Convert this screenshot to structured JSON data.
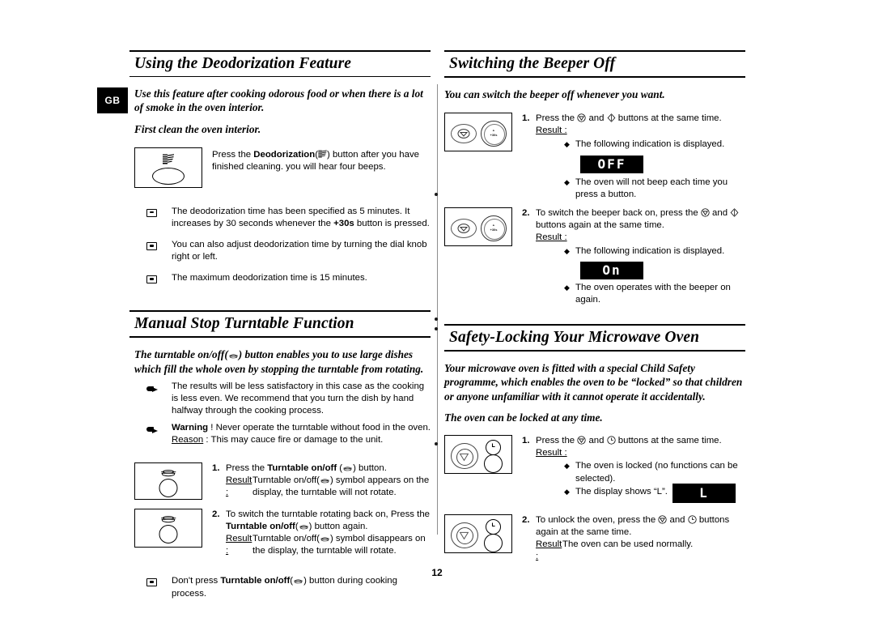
{
  "locale_badge": "GB",
  "page_number": "12",
  "left_column": {
    "sections": [
      {
        "id": "deodorization",
        "title": "Using the Deodorization Feature",
        "intro_1": "Use this feature after cooking odorous food or when there is a lot of smoke in the oven interior.",
        "intro_2": "First clean the oven interior.",
        "panel_icon": "deodorization-icon",
        "instruction_pre": "Press the ",
        "instruction_bold": "Deodorization",
        "instruction_paren_open": "(",
        "instruction_paren_close": ")",
        "instruction_post": " button after you have finished cleaning. you will hear four beeps.",
        "notes": [
          {
            "icon": "tv-note-icon",
            "text_pre": "The deodorization time has been specified as 5 minutes. It increases by 30 seconds whenever the ",
            "text_bold": "+30s",
            "text_post": " button is pressed."
          },
          {
            "icon": "tv-note-icon",
            "text_pre": "You can also adjust deodorization time by turning the dial knob right or left.",
            "text_bold": "",
            "text_post": ""
          },
          {
            "icon": "tv-note-icon",
            "text_pre": "The maximum deodorization time is 15 minutes.",
            "text_bold": "",
            "text_post": ""
          }
        ]
      },
      {
        "id": "manual-stop-turntable",
        "title": "Manual Stop Turntable Function",
        "intro_1_a": "The turntable on/off(",
        "intro_1_b": ") button enables you to use large dishes which fill the whole oven by stopping the turntable from rotating.",
        "hand_notes": [
          {
            "icon": "hand-note-icon",
            "text": "The results will be less satisfactory in this case as the cooking is less even. We recommend that you turn the dish by hand halfway through the cooking process."
          }
        ],
        "warning": {
          "icon": "hand-note-icon",
          "bold": "Warning",
          "text": " ! Never operate the turntable without food in the oven.",
          "reason_label": "Reason",
          "reason_text": " : This may cauce fire or damage to the unit."
        },
        "steps": [
          {
            "num": "1.",
            "line_pre": "Press the ",
            "line_bold": "Turntable on/off",
            "line_paren_open": " (",
            "line_paren_close": ")",
            "line_post": " button.",
            "result_label": "Result :",
            "result_pre": "Turntable on/off(",
            "result_post": ") symbol appears on the display, the turntable will not rotate."
          },
          {
            "num": "2.",
            "line_pre": "To switch the turntable rotating back on, Press the ",
            "line_bold": "Turntable on/off",
            "line_paren_open": "(",
            "line_paren_close": ")",
            "line_post": " button again.",
            "result_label": "Result :",
            "result_pre": "Turntable on/off(",
            "result_post": ") symbol disappears on the display, the turntable will rotate."
          }
        ],
        "footer_note": {
          "icon": "tv-note-icon",
          "pre": "Don't press ",
          "bold": "Turntable on/off",
          "paren_open": "(",
          "paren_close": ")",
          "post": " button during cooking process."
        }
      }
    ]
  },
  "right_column": {
    "sections": [
      {
        "id": "beeper-off",
        "title": "Switching the Beeper Off",
        "intro_1": "You can switch the beeper off whenever you want.",
        "steps": [
          {
            "num": "1.",
            "line_pre": "Press the ",
            "line_mid": " and ",
            "line_post": " buttons at the same time.",
            "result_label": "Result :",
            "bullets": [
              "The following indication is displayed."
            ],
            "led": "OFF",
            "bullets_after": [
              "The oven will not beep each time you press a button."
            ]
          },
          {
            "num": "2.",
            "line_pre": "To switch the beeper back on, press the ",
            "line_mid": " and ",
            "line_post": " buttons again at the same time.",
            "result_label": "Result :",
            "bullets": [
              "The following indication is displayed."
            ],
            "led": "On",
            "bullets_after": [
              "The oven operates with the beeper on again."
            ]
          }
        ]
      },
      {
        "id": "safety-locking",
        "title": "Safety-Locking Your Microwave Oven",
        "intro_1": "Your microwave oven is fitted with a special Child Safety programme, which enables the oven to be “locked” so that children or anyone unfamiliar with it cannot operate it accidentally.",
        "intro_2": "The oven can be locked at any time.",
        "steps": [
          {
            "num": "1.",
            "line_pre": "Press the ",
            "line_mid": " and ",
            "line_post": " buttons at the same time.",
            "result_label": "Result :",
            "bullets": [
              "The oven is locked (no functions can be selected).",
              "The display shows “L”."
            ],
            "led": "L"
          },
          {
            "num": "2.",
            "line_pre": "To unlock the oven, press the ",
            "line_mid": " and ",
            "line_post": " buttons again at the same time.",
            "result_label": "Result :",
            "result_text": "The oven can be used normally."
          }
        ]
      }
    ]
  }
}
